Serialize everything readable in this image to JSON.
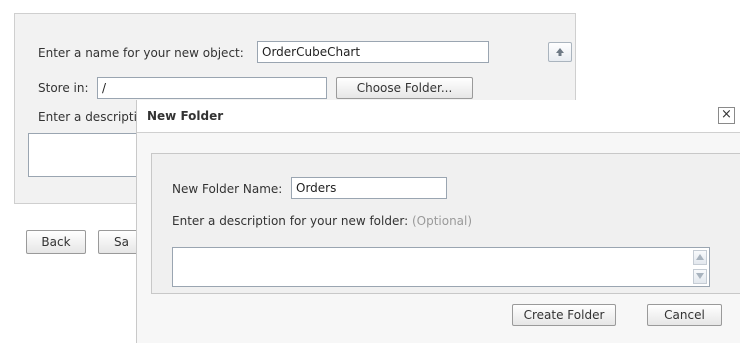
{
  "background_form": {
    "name_label": "Enter a name for your new object:",
    "name_value": "OrderCubeChart",
    "store_label": "Store in:",
    "store_value": "/",
    "choose_folder_label": "Choose Folder...",
    "desc_label": "Enter a descripti",
    "back_label": "Back",
    "save_label": "Sa"
  },
  "dialog": {
    "title": "New Folder",
    "close_glyph": "×",
    "folder_name_label": "New Folder Name:",
    "folder_name_value": "Orders",
    "desc_label": "Enter a description for your new folder:",
    "optional_label": "(Optional)",
    "create_label": "Create Folder",
    "cancel_label": "Cancel"
  }
}
